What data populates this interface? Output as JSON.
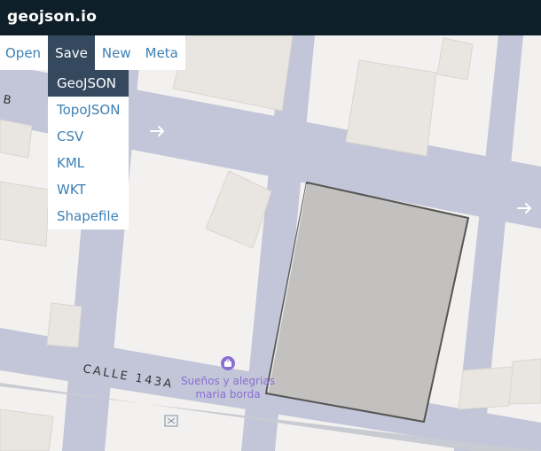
{
  "app": {
    "title": "geojson.io"
  },
  "menu": {
    "items": [
      {
        "label": "Open"
      },
      {
        "label": "Save"
      },
      {
        "label": "New"
      },
      {
        "label": "Meta"
      }
    ],
    "active": "Save"
  },
  "save_dropdown": {
    "items": [
      {
        "label": "GeoJSON"
      },
      {
        "label": "TopoJSON"
      },
      {
        "label": "CSV"
      },
      {
        "label": "KML"
      },
      {
        "label": "WKT"
      },
      {
        "label": "Shapefile"
      }
    ],
    "highlighted": "GeoJSON"
  },
  "map": {
    "street_labels": {
      "calle": "CALLE 143A",
      "partial_top": "B"
    },
    "poi": {
      "name_line1": "Sueños y alegrias",
      "name_line2": "maria borda",
      "icon": "shopping-bag-icon"
    },
    "colors": {
      "road": "#c2c6d8",
      "block": "#f3f1ef",
      "building": "#e9e6e1",
      "polygon_fill": "#c2c1bf",
      "polygon_stroke": "#555555",
      "poi": "#8b6fd0"
    }
  }
}
